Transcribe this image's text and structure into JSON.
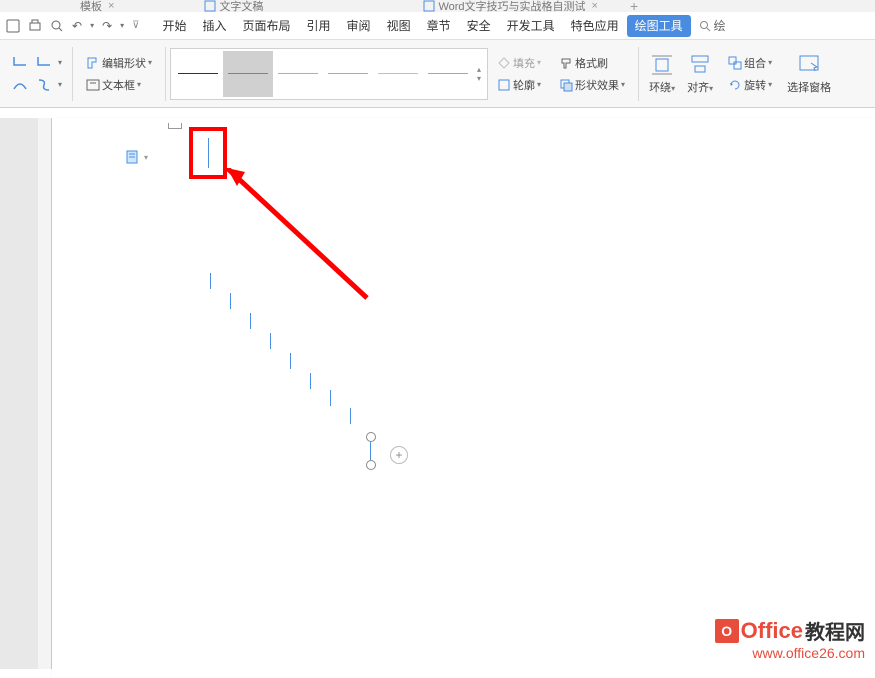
{
  "tabs": {
    "t1": "模板",
    "t2": "文字文稿",
    "t3": "Word文字技巧与实战格自测试"
  },
  "menu": {
    "start": "开始",
    "insert": "插入",
    "page_layout": "页面布局",
    "reference": "引用",
    "review": "审阅",
    "view": "视图",
    "chapter": "章节",
    "security": "安全",
    "dev_tools": "开发工具",
    "special": "特色应用",
    "drawing_tools": "绘图工具",
    "search": "绘"
  },
  "ribbon": {
    "edit_shape": "编辑形状",
    "textbox": "文本框",
    "fill": "填充",
    "outline": "轮廓",
    "format_painter": "格式刷",
    "shape_effects": "形状效果",
    "wrap": "环绕",
    "align": "对齐",
    "group": "组合",
    "rotate": "旋转",
    "selection_pane": "选择窗格"
  },
  "watermark": {
    "brand": "Office",
    "cn": "教程网",
    "url": "www.office26.com"
  }
}
